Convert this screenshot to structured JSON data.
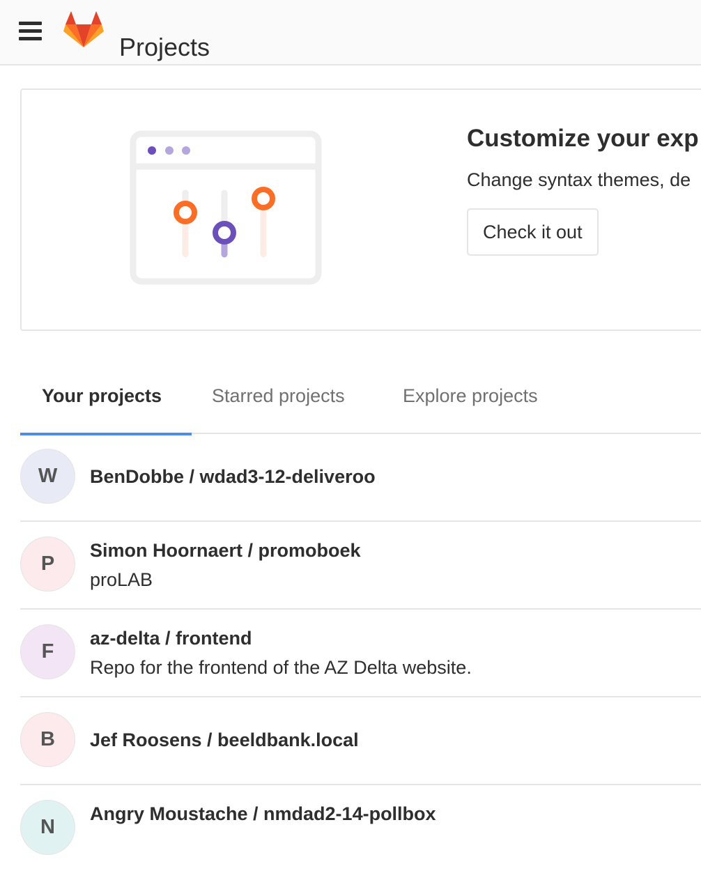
{
  "header": {
    "title": "Projects",
    "menu_icon": "hamburger-menu-icon",
    "logo_icon": "gitlab-tanuki-logo"
  },
  "callout": {
    "title": "Customize your exp",
    "text": "Change syntax themes, de",
    "button_label": "Check it out",
    "illustration": "preferences-sliders-illustration",
    "colors": {
      "orange": "#fc6d26",
      "purple": "#6b4fbb",
      "light_purple": "#b5a7dd",
      "frame": "#eeeeee"
    }
  },
  "tabs": [
    {
      "label": "Your projects",
      "active": true
    },
    {
      "label": "Starred projects",
      "active": false
    },
    {
      "label": "Explore projects",
      "active": false
    }
  ],
  "accent_color": "#4a8ee5",
  "projects": [
    {
      "avatar": "W",
      "avatar_color": "#e8eaf6",
      "name": "BenDobbe / wdad3-12-deliveroo",
      "description": ""
    },
    {
      "avatar": "P",
      "avatar_color": "#fdeaed",
      "name": "Simon Hoornaert / promoboek",
      "description": "proLAB"
    },
    {
      "avatar": "F",
      "avatar_color": "#f3e5f5",
      "name": "az-delta / frontend",
      "description": "Repo for the frontend of the AZ Delta website."
    },
    {
      "avatar": "B",
      "avatar_color": "#fdeaed",
      "name": "Jef Roosens / beeldbank.local",
      "description": ""
    },
    {
      "avatar": "N",
      "avatar_color": "#e0f2f1",
      "name": "Angry Moustache / nmdad2-14-pollbox",
      "description": ""
    }
  ]
}
